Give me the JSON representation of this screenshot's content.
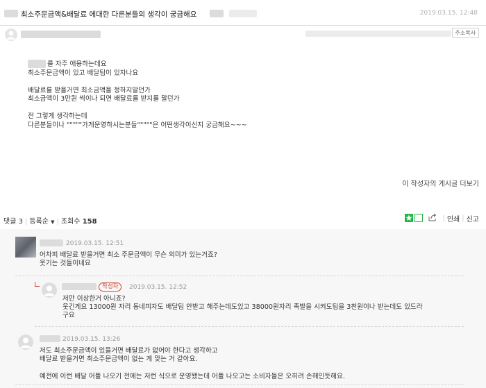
{
  "post": {
    "title": "최소주문금액&배달료 에대한 다른분들의 생각이 궁금해요",
    "date": "2019.03.15. 12:48",
    "copy_url_label": "주소복사",
    "body_lines": [
      "를 자주 애용하는데요",
      "최소주문금액이 있고 배달팁이 있자나요",
      "배달료를 받을거면 최소금액을 정하지말던가",
      "최소금액이 3만원 씩이나 되면 배달료를 받지를 말던가",
      "전 그렇게 생각하는데",
      "다른분들이나 \"\"\"\"\"가게운영하시는분들\"\"\"\"\"은 어떤생각이신지 궁금해요~~~"
    ],
    "more_posts_label": "이 작성자의 게시글 더보기"
  },
  "toolbar": {
    "comments_label": "댓글",
    "comments_count": "3",
    "sort_label": "등록순",
    "views_label": "조회수",
    "views_count": "158",
    "print_label": "인쇄",
    "report_label": "신고",
    "share_icon": "share-icon",
    "colors": {
      "green": "#28b44a"
    }
  },
  "comments": [
    {
      "date": "2019.03.15. 12:51",
      "lines": [
        "어차피 배달료 받을거면 최소 주문금액이 무슨 의미가 있는거죠?",
        "웃기는 것들이네요"
      ]
    },
    {
      "badge": "작성자",
      "date": "2019.03.15. 12:52",
      "lines": [
        "저만 이상한거 아니죠?",
        "웃긴게요 13000원 자리 동네피자도 배달팁 안받고 해주는데도있고 38000원자리 족발을 시켜도팁을 3천원이나 받는데도 있드라",
        "구요"
      ]
    },
    {
      "date": "2019.03.15. 13:26",
      "lines": [
        "저도 최소주문금액이 있을거면 배달료가 없어야 한다고 생각하고",
        "배달료 받을거면 최소주문금액이 없는 게 맞는 거 같아요.",
        "",
        "예전에 이런 배달 어플 나오기 전에는 저런 식으로 운영됐는데 어플 나오고는 소비자들은 오히려 손해인듯해요."
      ]
    }
  ]
}
